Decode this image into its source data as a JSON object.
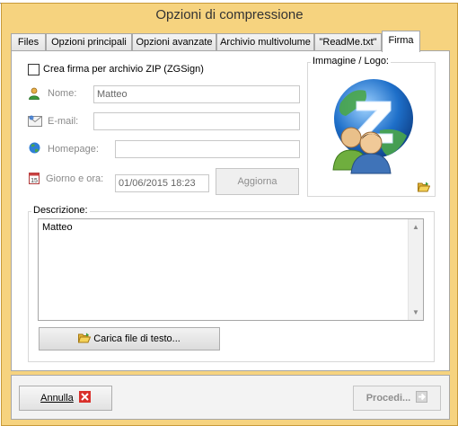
{
  "window": {
    "title": "Opzioni di compressione"
  },
  "tabs": [
    {
      "label": "Files"
    },
    {
      "label": "Opzioni principali"
    },
    {
      "label": "Opzioni avanzate"
    },
    {
      "label": "Archivio multivolume"
    },
    {
      "label": "\"ReadMe.txt\""
    },
    {
      "label": "Firma",
      "active": true
    }
  ],
  "signature": {
    "create_label": "Crea firma per archivio ZIP (ZGSign)",
    "create_checked": false,
    "name_label": "Nome:",
    "name_value": "Matteo",
    "email_label": "E-mail:",
    "email_value": "",
    "homepage_label": "Homepage:",
    "homepage_value": "",
    "datetime_label": "Giorno e ora:",
    "datetime_value": "01/06/2015 18:23",
    "update_button": "Aggiorna"
  },
  "image_logo": {
    "label": "Immagine / Logo:"
  },
  "description": {
    "label": "Descrizione:",
    "value": "Matteo",
    "load_button": "Carica file di testo..."
  },
  "footer": {
    "cancel_button": "Annulla",
    "proceed_button": "Procedi..."
  },
  "colors": {
    "window_frame": "#f6d37f",
    "cancel_icon": "#d9302b",
    "globe_blue": "#1e6fc9",
    "globe_green": "#4aa64a"
  }
}
